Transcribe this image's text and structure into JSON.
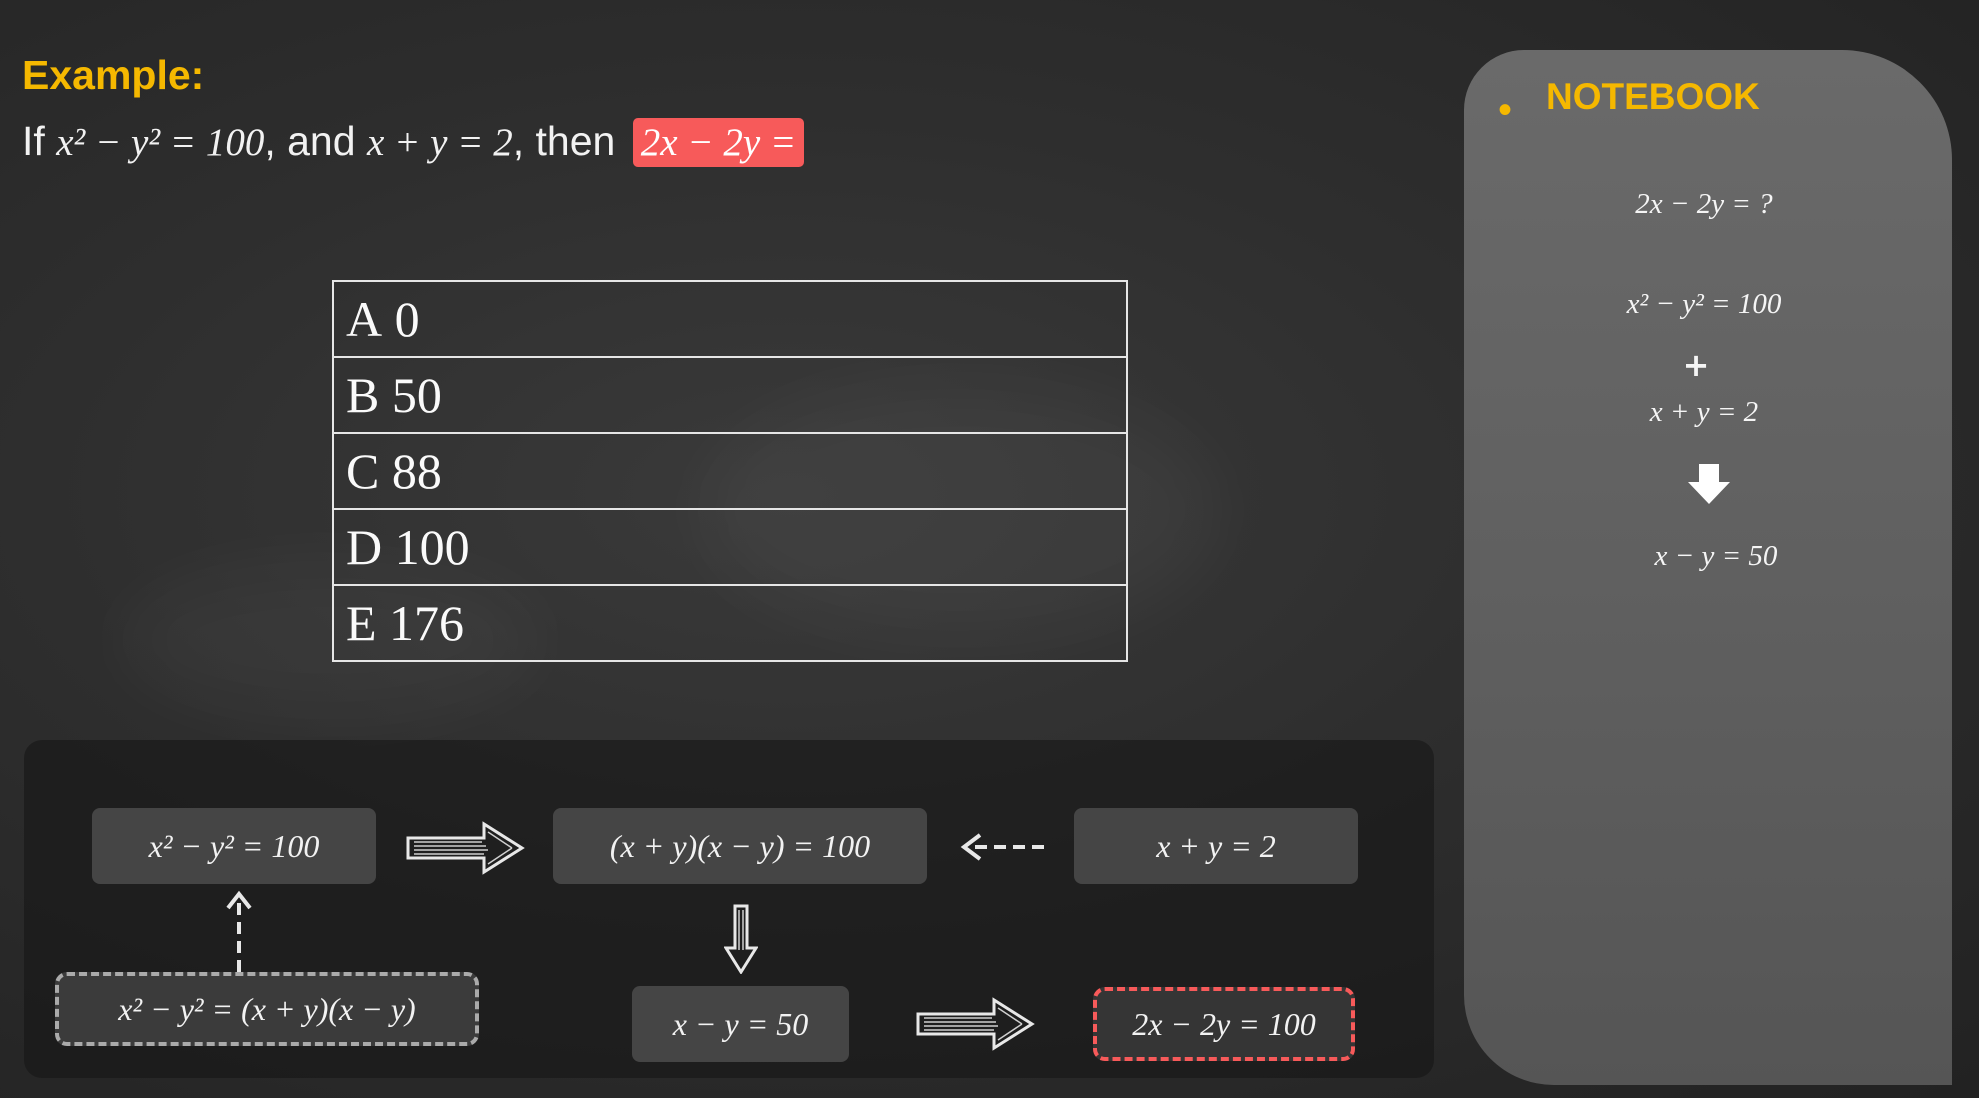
{
  "header": {
    "label": "Example:",
    "question_prefix": "If",
    "question_eq1": "x² − y² = 100",
    "question_and": ", and",
    "question_eq2": "x + y = 2",
    "question_then": ", then",
    "question_highlight": "2x − 2y ="
  },
  "choices": [
    {
      "letter": "A",
      "value": "0"
    },
    {
      "letter": "B",
      "value": "50"
    },
    {
      "letter": "C",
      "value": "88"
    },
    {
      "letter": "D",
      "value": "100"
    },
    {
      "letter": "E",
      "value": "176"
    }
  ],
  "diagram": {
    "box_difference": "x² − y² = 100",
    "box_factored": "(x + y)(x − y) = 100",
    "box_sum": "x + y = 2",
    "box_identity": "x² − y² = (x + y)(x − y)",
    "box_result_diff": "x − y = 50",
    "box_answer": "2x − 2y = 100"
  },
  "notebook": {
    "title": "NOTEBOOK",
    "bullet": "•",
    "line_goal": "2x − 2y = ?",
    "line_eq1": "x² − y² = 100",
    "line_plus": "+",
    "line_eq2": "x + y = 2",
    "line_result": "x − y = 50"
  },
  "colors": {
    "accent_yellow": "#f5b800",
    "highlight_red": "#f75a5a",
    "box_grey": "#454545",
    "notebook_bg": "#5e5e5e"
  }
}
